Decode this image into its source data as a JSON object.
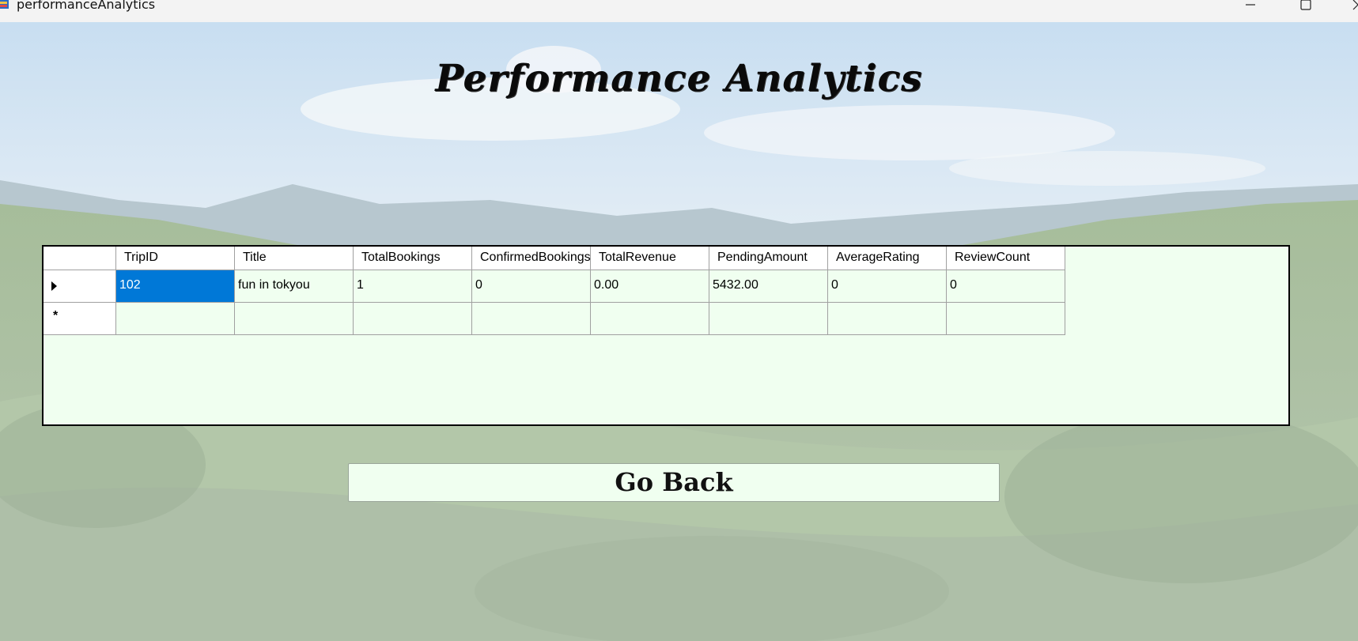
{
  "window": {
    "title": "performanceAnalytics"
  },
  "page": {
    "title": "Performance Analytics"
  },
  "grid": {
    "columns": [
      "TripID",
      "Title",
      "TotalBookings",
      "ConfirmedBookings",
      "TotalRevenue",
      "PendingAmount",
      "AverageRating",
      "ReviewCount"
    ],
    "rows": [
      [
        "102",
        "fun in tokyou",
        "1",
        "0",
        "0.00",
        "5432.00",
        "0",
        "0"
      ]
    ],
    "new_row_marker": "*",
    "selected_cell": {
      "row": 0,
      "column": "TripID"
    }
  },
  "buttons": {
    "go_back": "Go Back"
  },
  "colors": {
    "grid_bg": "#f0fff0",
    "selection": "#0078d7",
    "button_bg": "#f0fff0"
  }
}
